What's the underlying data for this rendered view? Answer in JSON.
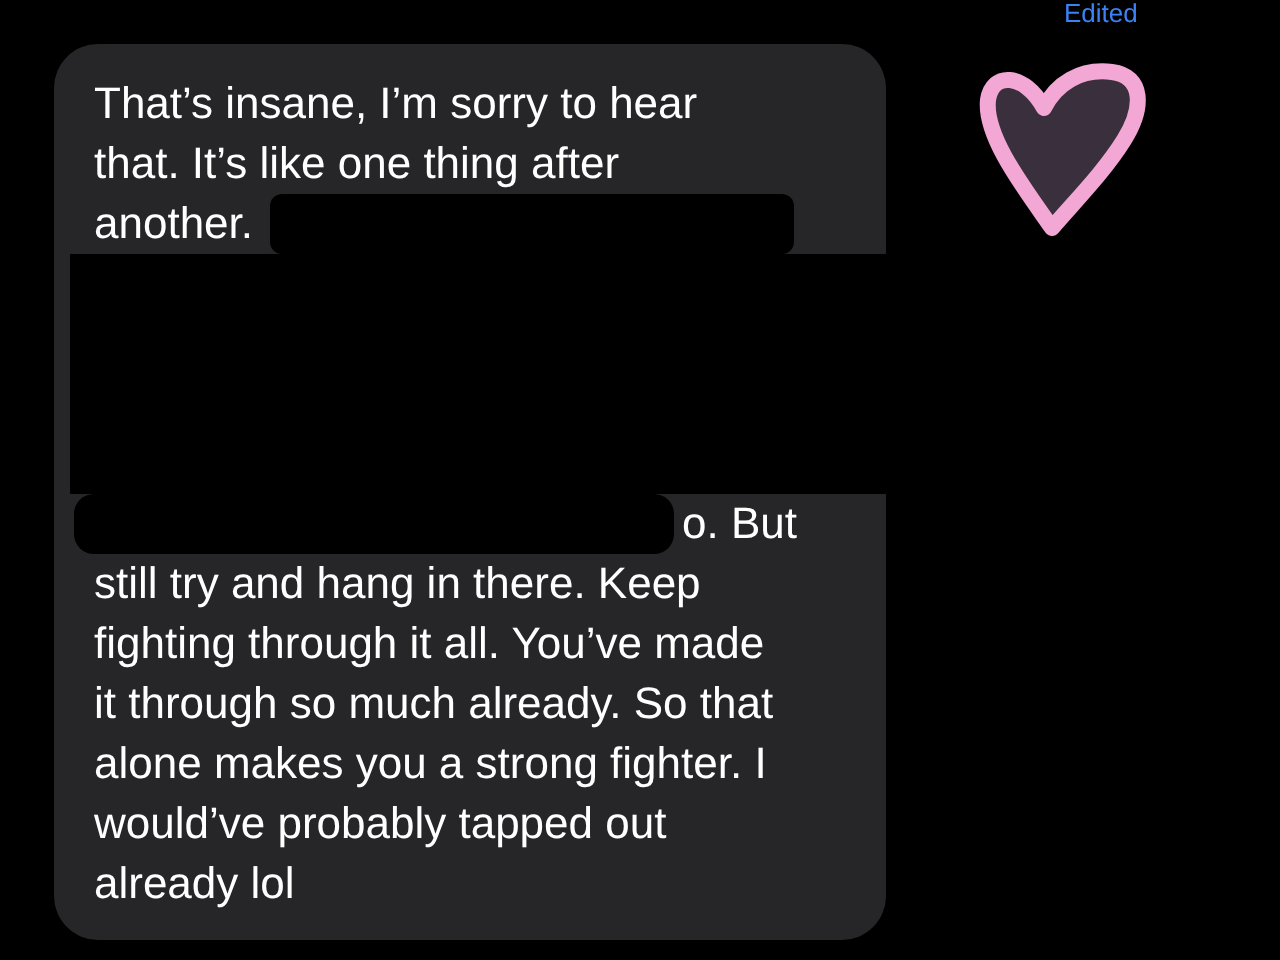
{
  "edited_label": "Edited",
  "message": {
    "lines": [
      {
        "kind": "text",
        "text": "That’s insane, I’m sorry to hear"
      },
      {
        "kind": "text",
        "text": "that. It’s like one thing after"
      },
      {
        "kind": "redacted_after",
        "text": "another."
      },
      {
        "kind": "redacted"
      },
      {
        "kind": "redacted"
      },
      {
        "kind": "redacted"
      },
      {
        "kind": "redacted"
      },
      {
        "kind": "redacted_before",
        "text": "o. But"
      },
      {
        "kind": "text",
        "text": "still try and hang in there. Keep"
      },
      {
        "kind": "text",
        "text": "fighting through it all. You’ve made"
      },
      {
        "kind": "text",
        "text": "it through so much already. So that"
      },
      {
        "kind": "text",
        "text": "alone makes you a strong fighter. I"
      },
      {
        "kind": "text",
        "text": "would’ve probably tapped out"
      },
      {
        "kind": "text",
        "text": "already lol"
      }
    ]
  },
  "reaction": {
    "kind": "heart"
  }
}
